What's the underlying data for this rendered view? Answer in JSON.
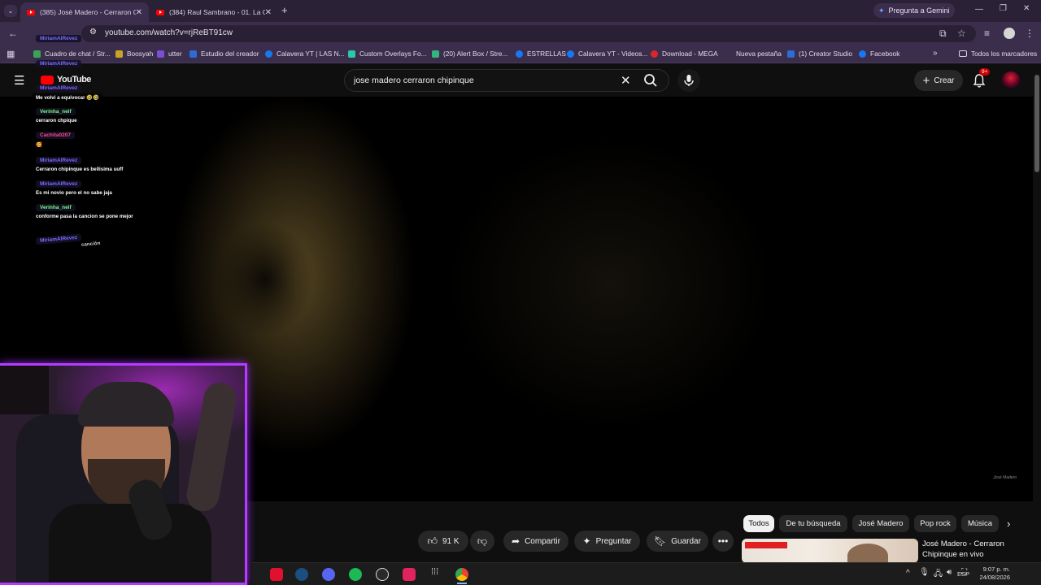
{
  "browser": {
    "tabs": [
      {
        "title": "(385) José Madero - Cerraron Ch",
        "active": true
      },
      {
        "title": "(384) Raul Sambrano - 01. La Gu",
        "active": false
      }
    ],
    "gemini_label": "Pregunta a Gemini",
    "url": "youtube.com/watch?v=rjReBT91cw",
    "bookmarks": [
      {
        "label": "Cuadro de chat / Str...",
        "color": "#3aa35a"
      },
      {
        "label": "Boosyah",
        "color": "#c9a227"
      },
      {
        "label": "utter",
        "color": "#7a4fd6"
      },
      {
        "label": "Estudio del creador",
        "color": "#2d6bd6"
      },
      {
        "label": "Calavera YT | LAS N...",
        "color": "#1877f2"
      },
      {
        "label": "Custom Overlays Fo...",
        "color": "#2dc6a8"
      },
      {
        "label": "(20) Alert Box / Stre...",
        "color": "#36b37e"
      },
      {
        "label": "ESTRELLAS",
        "color": "#1877f2"
      },
      {
        "label": "Calavera YT - Videos...",
        "color": "#1877f2"
      },
      {
        "label": "Download - MEGA",
        "color": "#d9272e"
      },
      {
        "label": "Nueva pestaña",
        "color": ""
      },
      {
        "label": "(1) Creator Studio",
        "color": "#2d6bd6"
      },
      {
        "label": "Facebook",
        "color": "#1877f2"
      }
    ],
    "all_bookmarks": "Todos los marcadores"
  },
  "youtube": {
    "logo": "YouTube",
    "search_value": "jose madero cerraron chipinque",
    "create_label": "Crear",
    "notification_count": "9+",
    "watermark": "José Madero"
  },
  "chat": [
    {
      "name": "MiriamAlRevez",
      "message": ""
    },
    {
      "name": "MiriamAlRevez",
      "message": ""
    },
    {
      "name": "MiriamAlRevez",
      "message": "Me volvi a equivocar 🤣🤣"
    },
    {
      "name": "Verinha_neif",
      "message": "cerraron chpique"
    },
    {
      "name": "Cachita0207",
      "message": "🥰"
    },
    {
      "name": "MiriamAlRevez",
      "message": "Cerraron chipinque es bellisima uuff"
    },
    {
      "name": "MiriamAlRevez",
      "message": "Es mi novio pero el no sabe jaja"
    },
    {
      "name": "Verinha_neif",
      "message": "conforme pasa la cancion se pone mejor"
    },
    {
      "name": "MiriamAlRevez",
      "message": "canción"
    }
  ],
  "actions": {
    "likes": "91 K",
    "share": "Compartir",
    "ask": "Preguntar",
    "save": "Guardar"
  },
  "chips": [
    "Todos",
    "De tu búsqueda",
    "José Madero",
    "Pop rock",
    "Música"
  ],
  "recommendation": {
    "title_line1": "José Madero - Cerraron",
    "title_line2": "Chipinque en vivo"
  },
  "taskbar": {
    "language": "ESP",
    "time": "9:07 p. m.",
    "date": "24/08/2026"
  }
}
